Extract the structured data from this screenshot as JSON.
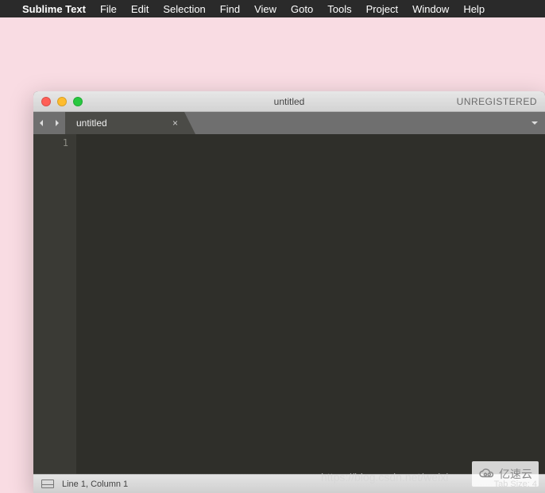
{
  "menubar": {
    "app_name": "Sublime Text",
    "items": [
      "File",
      "Edit",
      "Selection",
      "Find",
      "View",
      "Goto",
      "Tools",
      "Project",
      "Window",
      "Help"
    ]
  },
  "window": {
    "title": "untitled",
    "registration": "UNREGISTERED"
  },
  "tabs": [
    {
      "label": "untitled"
    }
  ],
  "editor": {
    "gutter_lines": [
      "1"
    ]
  },
  "statusbar": {
    "position": "Line 1, Column 1",
    "tab_size": "Tab Size: 4"
  },
  "watermark": {
    "url_fragment": "https://blog.csdn.net/weixi",
    "logo_text": "亿速云"
  }
}
